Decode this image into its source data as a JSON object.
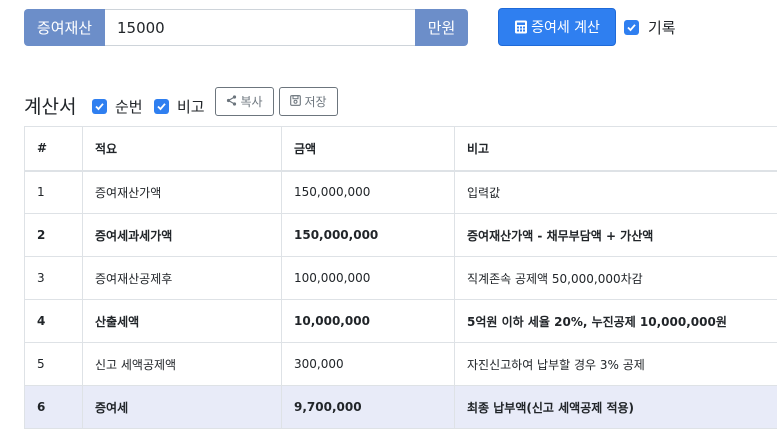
{
  "top_bar": {
    "label": "증여재산",
    "amount_value": "15000",
    "unit": "만원",
    "calculate_label": "증여세 계산",
    "record_label": "기록",
    "record_checked": true
  },
  "statement": {
    "title": "계산서",
    "seq_label": "순번",
    "seq_checked": true,
    "note_label": "비고",
    "note_checked": true,
    "copy_label": "복사",
    "save_label": "저장"
  },
  "table": {
    "headers": [
      "#",
      "적요",
      "금액",
      "비고"
    ],
    "rows": [
      {
        "num": "1",
        "item": "증여재산가액",
        "amount": "150,000,000",
        "note": "입력값",
        "style": "normal"
      },
      {
        "num": "2",
        "item": "증여세과세가액",
        "amount": "150,000,000",
        "note": "증여재산가액 - 채무부담액 + 가산액",
        "style": "bold"
      },
      {
        "num": "3",
        "item": "증여재산공제후",
        "amount": "100,000,000",
        "note": "직계존속 공제액 50,000,000차감",
        "style": "normal"
      },
      {
        "num": "4",
        "item": "산출세액",
        "amount": "10,000,000",
        "note": "5억원 이하 세율 20%, 누진공제 10,000,000원",
        "style": "bold"
      },
      {
        "num": "5",
        "item": "신고 세액공제액",
        "amount": "300,000",
        "note": "자진신고하여 납부할 경우 3% 공제",
        "style": "normal"
      },
      {
        "num": "6",
        "item": "증여세",
        "amount": "9,700,000",
        "note": "최종 납부액(신고 세액공제 적용)",
        "style": "final"
      }
    ]
  },
  "icons": {
    "calculator": "calculator-icon",
    "check": "check-icon",
    "share": "share-icon",
    "save": "save-icon"
  },
  "colors": {
    "addon": "#6c8ec9",
    "primary": "#2f7ff0",
    "final_row": "#e8ebf8"
  }
}
